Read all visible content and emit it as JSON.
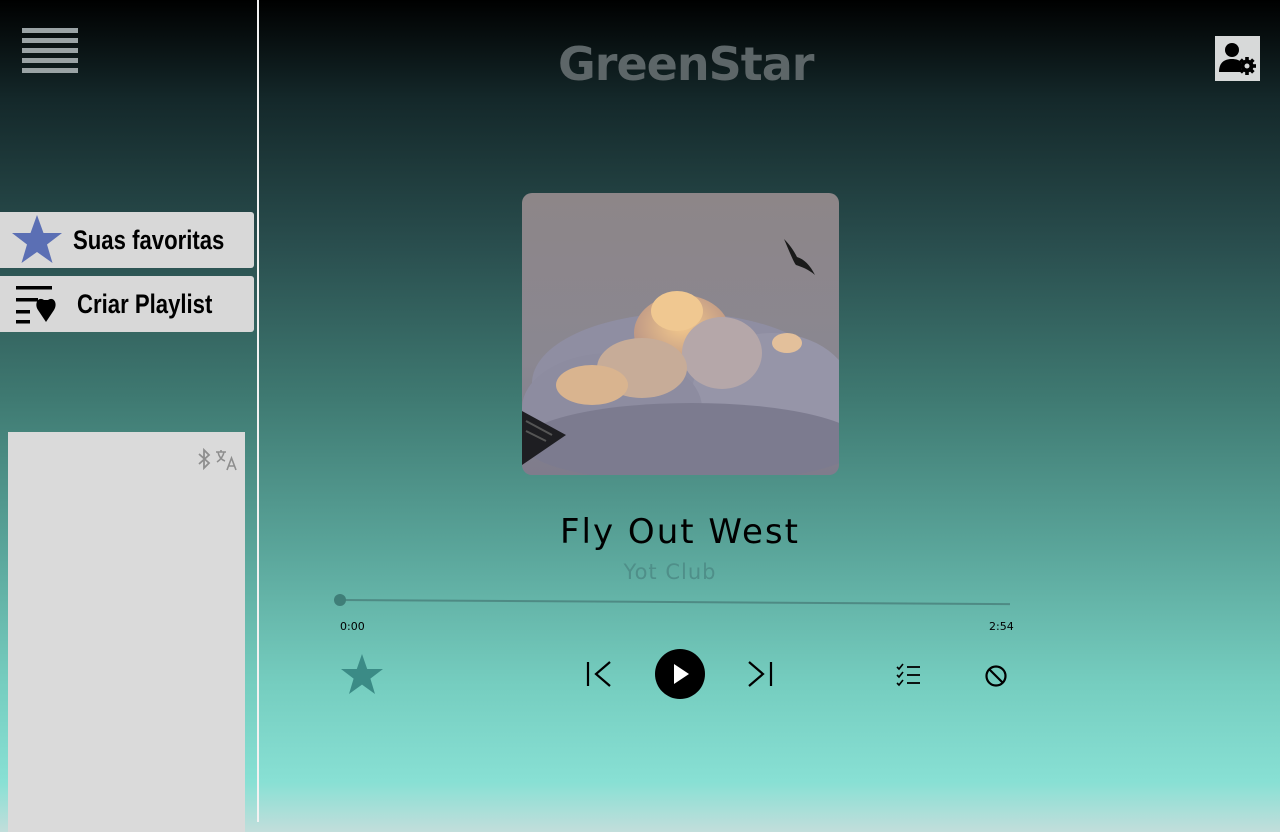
{
  "header": {
    "logo_text": "GreenStar",
    "menu_icon": "hamburger-menu-icon",
    "profile_icon": "user-settings-icon"
  },
  "sidebar": {
    "items": [
      {
        "label": "Suas favoritas",
        "icon": "star-icon",
        "icon_color": "#5b6fb4"
      },
      {
        "label": "Criar Playlist",
        "icon": "playlist-heart-icon"
      }
    ],
    "ad_icons": [
      "bluetooth-icon",
      "translate-icon"
    ]
  },
  "player": {
    "title": "Fly Out West",
    "artist": "Yot Club",
    "current_time": "0:00",
    "total_time": "2:54",
    "progress": 0,
    "controls": [
      "favorite-star-icon",
      "previous-icon",
      "play-icon",
      "next-icon",
      "queue-list-icon",
      "block-icon"
    ]
  },
  "colors": {
    "accent_star": "#3b8b86",
    "sidebar_star": "#5b6fb4",
    "artist_text": "#4f8f89"
  }
}
